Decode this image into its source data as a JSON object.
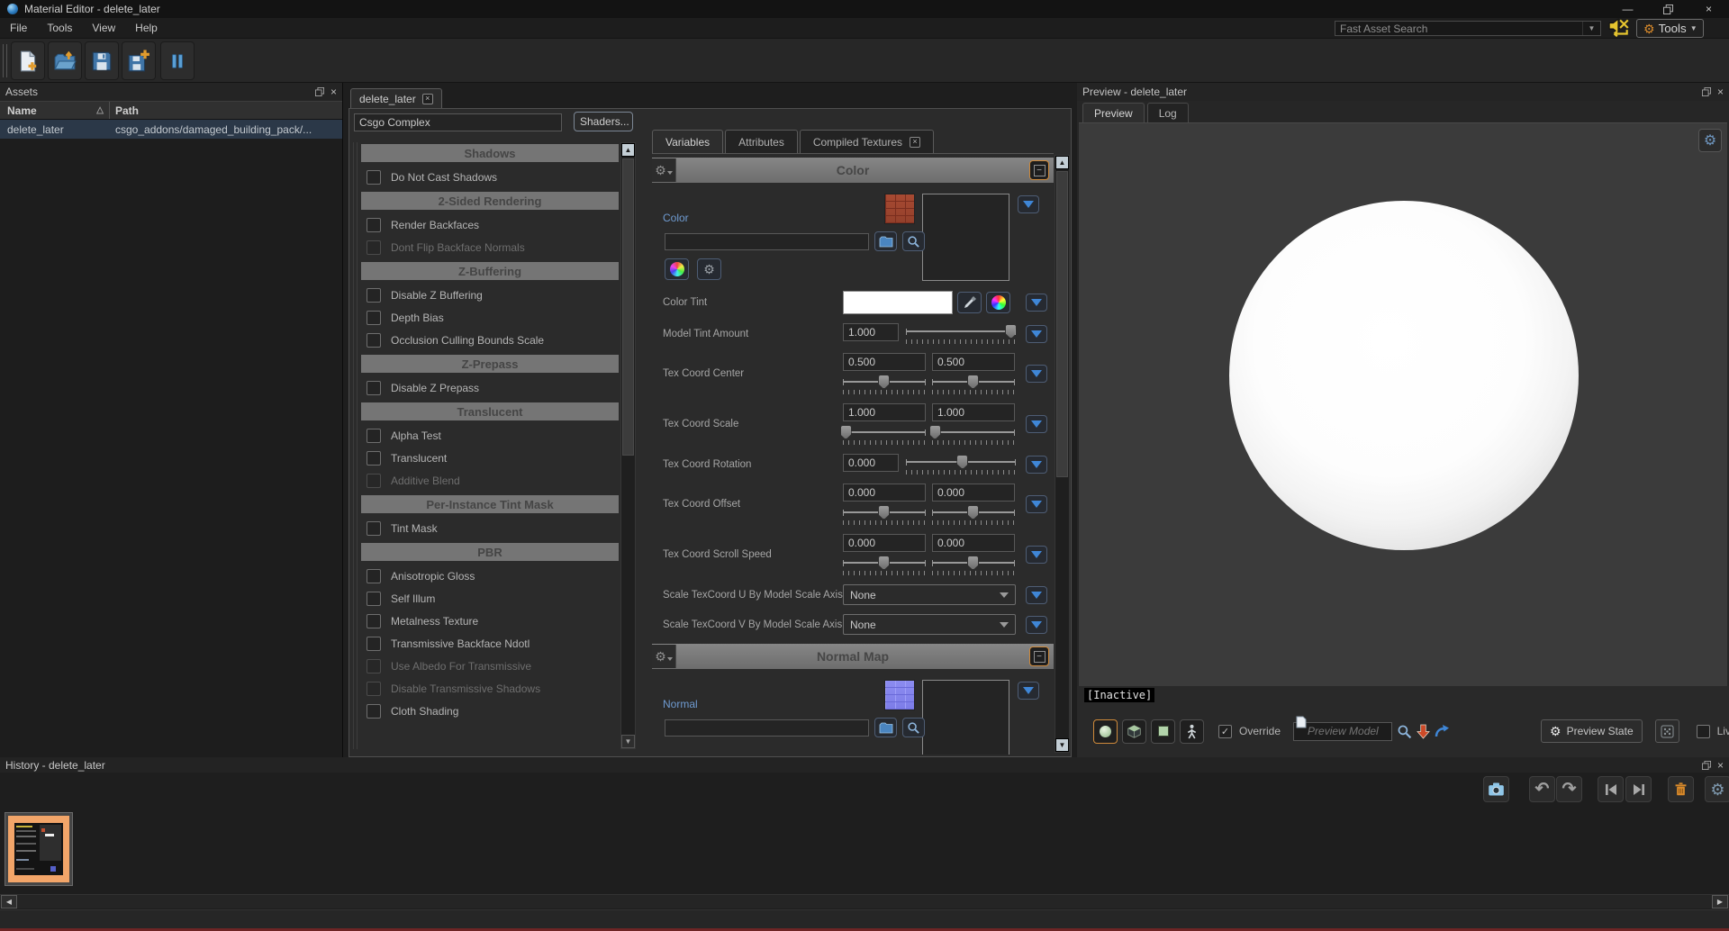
{
  "glyphs": {
    "close": "×",
    "collapse": "−",
    "up": "▲",
    "down": "▼",
    "left": "◀",
    "right": "▶",
    "sort_asc": "△",
    "check": "✓",
    "gear": "⚙",
    "undo": "↶",
    "redo": "↷",
    "minimize": "—"
  },
  "colors": {
    "accent_orange": "#cf8a3b",
    "accent_blue": "#3f86d6",
    "selected_row": "#2b3848",
    "viewport_bg": "#3b3b3b",
    "status_red": "#6e2525"
  },
  "window": {
    "title": "Material Editor - delete_later",
    "menus": [
      "File",
      "Tools",
      "View",
      "Help"
    ],
    "search_placeholder": "Fast Asset Search",
    "tools_label": "Tools"
  },
  "toolbar": {
    "buttons": [
      {
        "icon": "new-asset"
      },
      {
        "icon": "open-asset"
      },
      {
        "icon": "save"
      },
      {
        "icon": "save-as"
      },
      {
        "icon": "pause"
      }
    ]
  },
  "assets": {
    "title": "Assets",
    "columns": [
      "Name",
      "Path"
    ],
    "rows": [
      {
        "name": "delete_later",
        "path": "csgo_addons/damaged_building_pack/..."
      }
    ]
  },
  "editor": {
    "tab_label": "delete_later",
    "shader_value": "Csgo Complex",
    "shaders_button": "Shaders...",
    "flag_sections": [
      {
        "header": "Shadows",
        "items": [
          {
            "label": "Do Not Cast Shadows",
            "checked": false,
            "enabled": true
          }
        ]
      },
      {
        "header": "2-Sided Rendering",
        "items": [
          {
            "label": "Render Backfaces",
            "checked": false,
            "enabled": true
          },
          {
            "label": "Dont Flip Backface Normals",
            "checked": false,
            "enabled": false
          }
        ]
      },
      {
        "header": "Z-Buffering",
        "items": [
          {
            "label": "Disable Z Buffering",
            "checked": false,
            "enabled": true
          },
          {
            "label": "Depth Bias",
            "checked": false,
            "enabled": true
          },
          {
            "label": "Occlusion Culling Bounds Scale",
            "checked": false,
            "enabled": true
          }
        ]
      },
      {
        "header": "Z-Prepass",
        "items": [
          {
            "label": "Disable Z Prepass",
            "checked": false,
            "enabled": true
          }
        ]
      },
      {
        "header": "Translucent",
        "items": [
          {
            "label": "Alpha Test",
            "checked": false,
            "enabled": true
          },
          {
            "label": "Translucent",
            "checked": false,
            "enabled": true
          },
          {
            "label": "Additive Blend",
            "checked": false,
            "enabled": false
          }
        ]
      },
      {
        "header": "Per-Instance Tint Mask",
        "items": [
          {
            "label": "Tint Mask",
            "checked": false,
            "enabled": true
          }
        ]
      },
      {
        "header": "PBR",
        "items": [
          {
            "label": "Anisotropic Gloss",
            "checked": false,
            "enabled": true
          },
          {
            "label": "Self Illum",
            "checked": false,
            "enabled": true
          },
          {
            "label": "Metalness Texture",
            "checked": false,
            "enabled": true
          },
          {
            "label": "Transmissive Backface Ndotl",
            "checked": false,
            "enabled": true
          },
          {
            "label": "Use Albedo For Transmissive",
            "checked": false,
            "enabled": false
          },
          {
            "label": "Disable Transmissive Shadows",
            "checked": false,
            "enabled": false
          },
          {
            "label": "Cloth Shading",
            "checked": false,
            "enabled": true
          }
        ]
      }
    ],
    "var_tabs": [
      {
        "label": "Variables",
        "active": true
      },
      {
        "label": "Attributes",
        "active": false
      },
      {
        "label": "Compiled Textures",
        "active": false,
        "closable": true
      }
    ],
    "sections": [
      {
        "title": "Color",
        "rows": [
          {
            "type": "texture",
            "label": "Color",
            "value": "",
            "thumb": "brick",
            "extra_buttons": true
          },
          {
            "type": "color",
            "label": "Color Tint",
            "swatch": "#ffffff"
          },
          {
            "type": "slider",
            "label": "Model Tint Amount",
            "values": [
              "1.000"
            ],
            "positions": [
              96
            ]
          },
          {
            "type": "slider",
            "label": "Tex Coord Center",
            "values": [
              "0.500",
              "0.500"
            ],
            "positions": [
              50,
              50
            ]
          },
          {
            "type": "slider",
            "label": "Tex Coord Scale",
            "values": [
              "1.000",
              "1.000"
            ],
            "positions": [
              4,
              4
            ]
          },
          {
            "type": "slider",
            "label": "Tex Coord Rotation",
            "values": [
              "0.000"
            ],
            "positions": [
              52
            ]
          },
          {
            "type": "slider",
            "label": "Tex Coord Offset",
            "values": [
              "0.000",
              "0.000"
            ],
            "positions": [
              50,
              50
            ]
          },
          {
            "type": "slider",
            "label": "Tex Coord Scroll Speed",
            "values": [
              "0.000",
              "0.000"
            ],
            "positions": [
              50,
              50
            ]
          },
          {
            "type": "dropdown",
            "label": "Scale TexCoord U By Model Scale Axis",
            "value": "None"
          },
          {
            "type": "dropdown",
            "label": "Scale TexCoord V By Model Scale Axis",
            "value": "None"
          }
        ]
      },
      {
        "title": "Normal Map",
        "rows": [
          {
            "type": "texture",
            "label": "Normal",
            "value": "",
            "thumb": "normalmap",
            "extra_buttons": false
          }
        ]
      }
    ]
  },
  "preview": {
    "title": "Preview - delete_later",
    "tabs": [
      {
        "label": "Preview",
        "active": true
      },
      {
        "label": "Log",
        "active": false
      }
    ],
    "inactive_label": "[Inactive]",
    "modes": [
      {
        "name": "sphere",
        "selected": true
      },
      {
        "name": "cube",
        "selected": false
      },
      {
        "name": "plane",
        "selected": false
      },
      {
        "name": "model",
        "selected": false
      }
    ],
    "override_label": "Override",
    "override_checked": true,
    "model_placeholder": "Preview Model",
    "preview_state_label": "Preview State",
    "live_update_label": "Live Update",
    "live_update_checked": false
  },
  "history": {
    "title": "History - delete_later",
    "toolbar": [
      {
        "icon": "screenshot"
      },
      {
        "icon": "undo"
      },
      {
        "icon": "redo"
      },
      {
        "icon": "go-first"
      },
      {
        "icon": "go-last"
      },
      {
        "icon": "delete"
      },
      {
        "icon": "settings"
      }
    ],
    "entries": [
      {
        "selected": true
      }
    ]
  }
}
